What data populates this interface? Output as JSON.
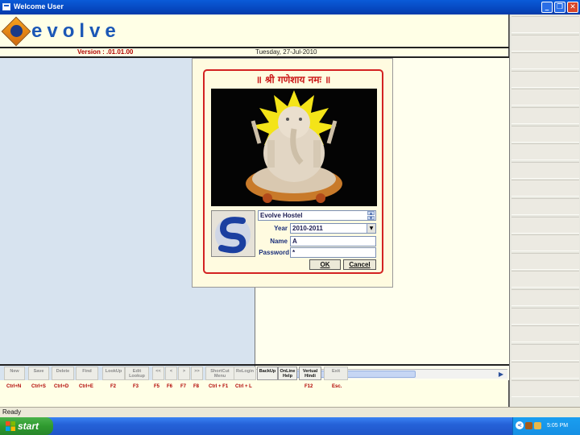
{
  "window": {
    "title": "Welcome User",
    "controls": {
      "minimize_icon": "minimize-icon",
      "maximize_icon": "restore-icon",
      "close_icon": "close-icon"
    }
  },
  "header": {
    "logo_text": "evolve",
    "version": "Version : .01.01.00",
    "date": "Tuesday, 27-Jul-2010"
  },
  "login": {
    "heading": "॥ श्री गणेशाय नमः ॥",
    "company": "Evolve Hostel",
    "year_label": "Year",
    "year_value": "2010-2011",
    "name_label": "Name",
    "name_value": "A",
    "password_label": "Password",
    "password_value": "*",
    "ok_label": "OK",
    "cancel_label": "Cancel"
  },
  "toolbar": {
    "buttons": [
      {
        "label": "New",
        "enabled": false
      },
      {
        "label": "Save",
        "enabled": false
      },
      {
        "label": "Delete",
        "enabled": false
      },
      {
        "label": "Find",
        "enabled": false
      },
      {
        "label": "LookUp",
        "enabled": false
      },
      {
        "label": "Edit Lookup",
        "enabled": false
      },
      {
        "label": "<<",
        "enabled": false
      },
      {
        "label": "<",
        "enabled": false
      },
      {
        "label": ">",
        "enabled": false
      },
      {
        "label": ">>",
        "enabled": false
      },
      {
        "label": "ShortCut Menu",
        "enabled": false
      },
      {
        "label": "ReLogin",
        "enabled": false
      },
      {
        "label": "BackUp",
        "enabled": true
      },
      {
        "label": "OnLine Help",
        "enabled": true
      },
      {
        "label": "Vertual Hindi",
        "enabled": true
      },
      {
        "label": "Exit",
        "enabled": false
      }
    ],
    "shortcuts": [
      "Ctrl+N",
      "Ctrl+S",
      "Ctrl+D",
      "Ctrl+E",
      "F2",
      "F3",
      "F5",
      "F6",
      "F7",
      "F8",
      "Ctrl + F1",
      "Ctrl + L",
      "F12",
      "Esc."
    ]
  },
  "status": {
    "text": "Ready"
  },
  "taskbar": {
    "start_label": "start",
    "clock": "5:05 PM"
  },
  "colors": {
    "titlebar": "#0a5bd8",
    "dialog_border": "#d32222",
    "shortcut_text": "#b00000",
    "left_pane": "#d7e3ef",
    "background": "#ffffe6"
  }
}
